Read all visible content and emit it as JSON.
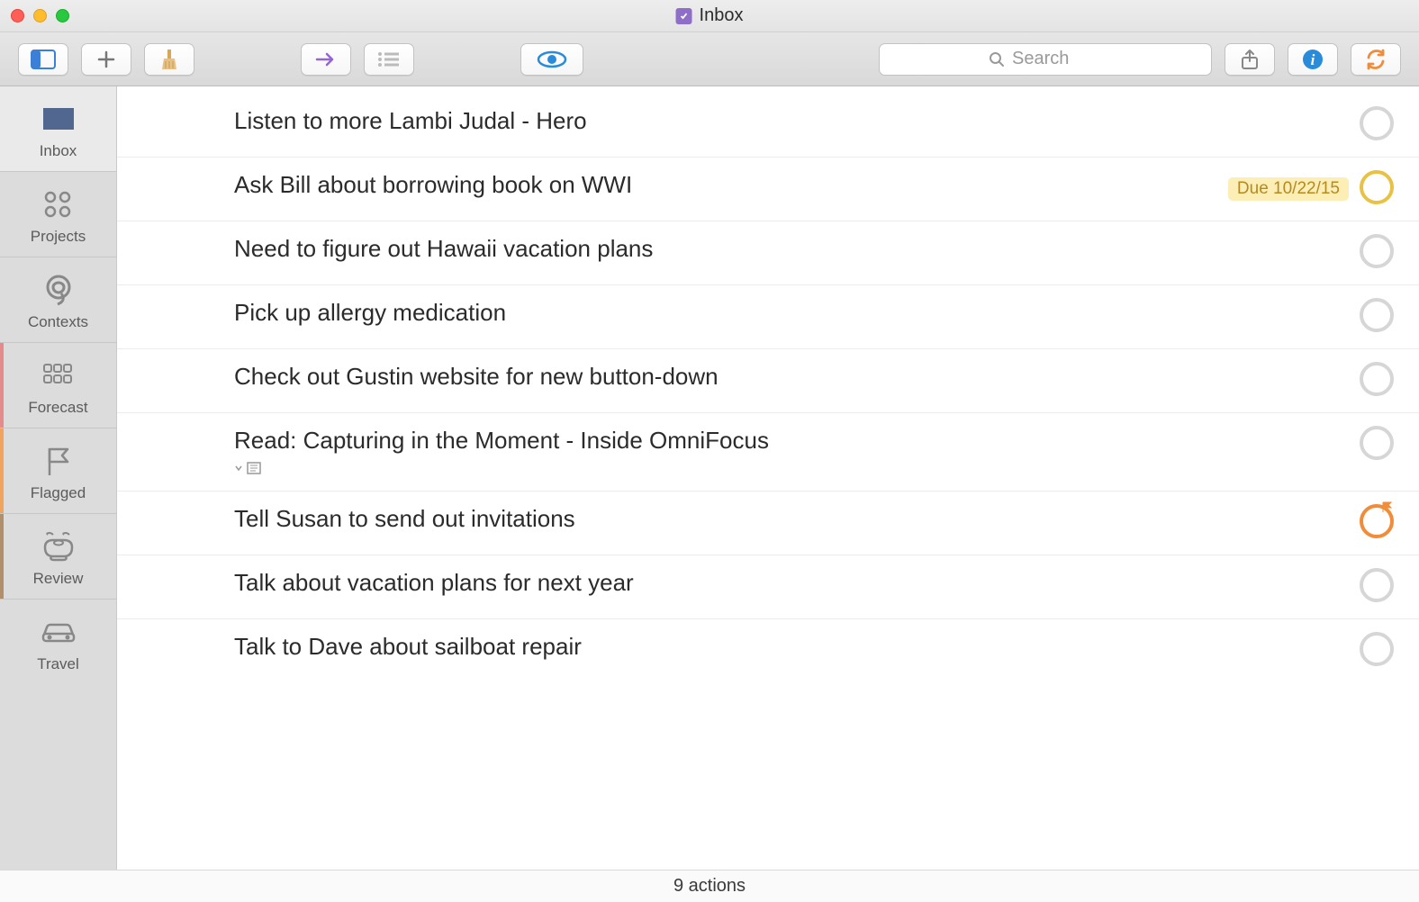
{
  "window": {
    "title": "Inbox"
  },
  "search": {
    "placeholder": "Search"
  },
  "sidebar": {
    "items": [
      {
        "label": "Inbox"
      },
      {
        "label": "Projects"
      },
      {
        "label": "Contexts"
      },
      {
        "label": "Forecast"
      },
      {
        "label": "Flagged"
      },
      {
        "label": "Review"
      },
      {
        "label": "Travel"
      }
    ]
  },
  "tasks": [
    {
      "title": "Listen to more Lambi Judal - Hero",
      "status": "normal"
    },
    {
      "title": "Ask Bill about borrowing book on WWI",
      "due": "Due 10/22/15",
      "status": "due"
    },
    {
      "title": "Need to figure out Hawaii vacation plans",
      "status": "normal"
    },
    {
      "title": "Pick up allergy medication",
      "status": "normal"
    },
    {
      "title": "Check out Gustin website for new button-down",
      "status": "normal"
    },
    {
      "title": "Read: Capturing in the Moment - Inside OmniFocus",
      "status": "normal",
      "has_note": true
    },
    {
      "title": "Tell Susan to send out invitations",
      "status": "flagged"
    },
    {
      "title": "Talk about vacation plans for next year",
      "status": "normal"
    },
    {
      "title": "Talk to Dave about sailboat repair",
      "status": "normal"
    }
  ],
  "statusbar": {
    "text": "9 actions"
  }
}
